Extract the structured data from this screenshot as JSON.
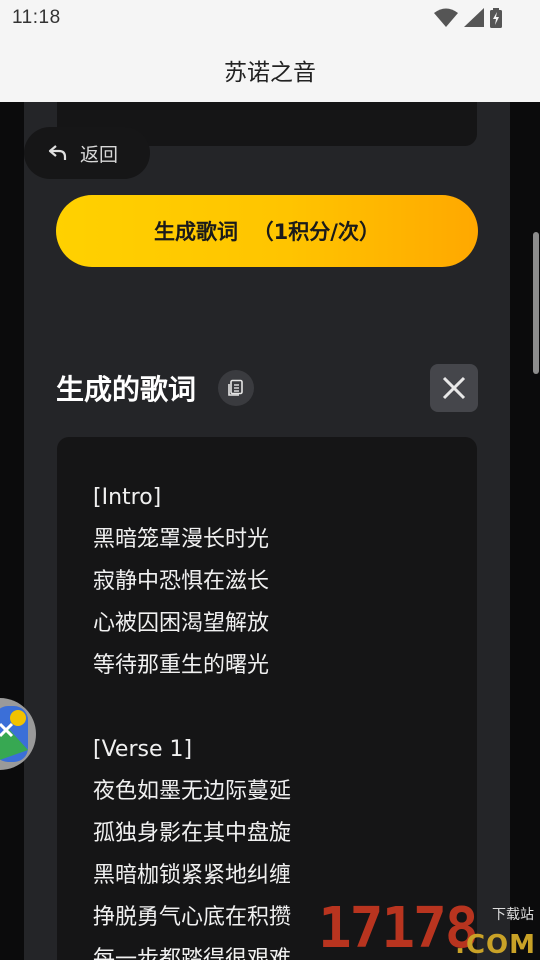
{
  "status_bar": {
    "time": "11:18",
    "icons": [
      "wifi-icon",
      "signal-icon",
      "battery-icon"
    ]
  },
  "app_bar": {
    "title": "苏诺之音"
  },
  "back": {
    "label": "返回",
    "icon": "back-arrow-icon"
  },
  "generate_button": {
    "label": "生成歌词  （1积分/次）"
  },
  "lyrics_section": {
    "title": "生成的歌词",
    "copy_icon": "copy-icon",
    "close_icon": "close-icon",
    "lines": [
      "[Intro]",
      "黑暗笼罩漫长时光",
      "寂静中恐惧在滋长",
      "心被囚困渴望解放",
      "等待那重生的曙光",
      "",
      "[Verse 1]",
      "夜色如墨无边际蔓延",
      "孤独身影在其中盘旋",
      "黑暗枷锁紧紧地纠缠",
      "挣脱勇气心底在积攒",
      "每一步都踏得很艰难"
    ]
  },
  "watermark": {
    "number": "17178",
    "site": "下载站",
    "suffix": ".COM"
  },
  "colors": {
    "accent_start": "#ffd100",
    "accent_end": "#ffa800",
    "page_bg": "#242528",
    "card_bg": "#151516"
  }
}
